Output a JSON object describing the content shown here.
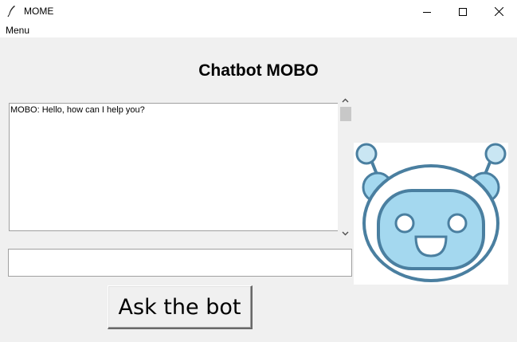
{
  "window": {
    "title": "MOME",
    "icons": {
      "app": "feather-icon",
      "minimize": "minimize-icon",
      "maximize": "maximize-icon",
      "close": "close-icon"
    }
  },
  "menubar": {
    "menu_label": "Menu"
  },
  "main": {
    "title": "Chatbot MOBO",
    "chat_log": [
      "MOBO: Hello, how can I help you?"
    ],
    "input_value": "",
    "ask_button_label": "Ask the bot",
    "robot_image": "robot-mascot-icon"
  },
  "colors": {
    "content_bg": "#f0f0f0",
    "robot_face": "#a4d8ef",
    "robot_outline": "#4a7fa0"
  }
}
